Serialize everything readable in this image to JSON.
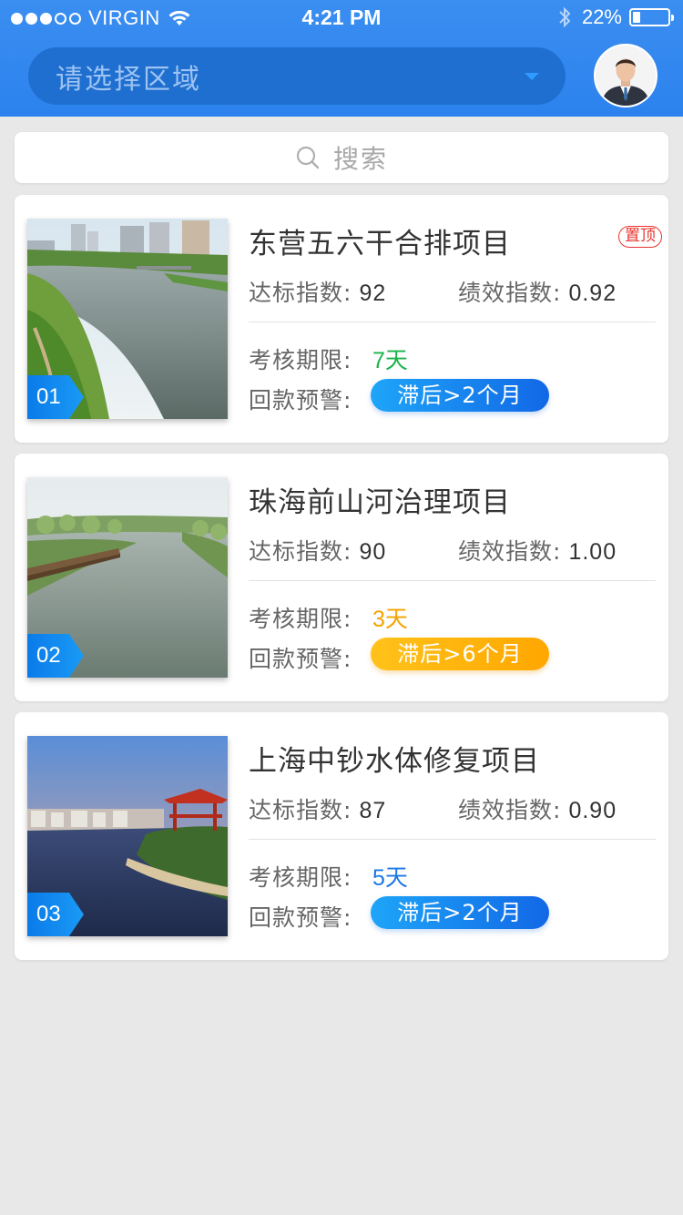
{
  "status_bar": {
    "carrier": "VIRGIN",
    "time": "4:21 PM",
    "battery_percent_text": "22%",
    "battery_level": 0.22
  },
  "header": {
    "region_placeholder": "请选择区域"
  },
  "search": {
    "placeholder": "搜索"
  },
  "labels": {
    "standard_index": "达标指数:",
    "performance_index": "绩效指数:",
    "assessment_period": "考核期限:",
    "payment_warning": "回款预警:"
  },
  "projects": [
    {
      "number": "01",
      "title": "东营五六干合排项目",
      "pinned_badge": "置顶",
      "standard_index": "92",
      "performance_index": "0.92",
      "deadline": "7天",
      "deadline_color": "#19b34a",
      "warning": "滞后>2个月",
      "warning_style": "blue"
    },
    {
      "number": "02",
      "title": "珠海前山河治理项目",
      "pinned_badge": "",
      "standard_index": "90",
      "performance_index": "1.00",
      "deadline": "3天",
      "deadline_color": "#f5a300",
      "warning": "滞后>6个月",
      "warning_style": "orange"
    },
    {
      "number": "03",
      "title": "上海中钞水体修复项目",
      "pinned_badge": "",
      "standard_index": "87",
      "performance_index": "0.90",
      "deadline": "5天",
      "deadline_color": "#1a78e6",
      "warning": "滞后>2个月",
      "warning_style": "blue"
    }
  ],
  "colors": {
    "header_blue": "#2c82ee",
    "region_pill": "#1f6fd0",
    "pin_red": "#e9352f"
  }
}
